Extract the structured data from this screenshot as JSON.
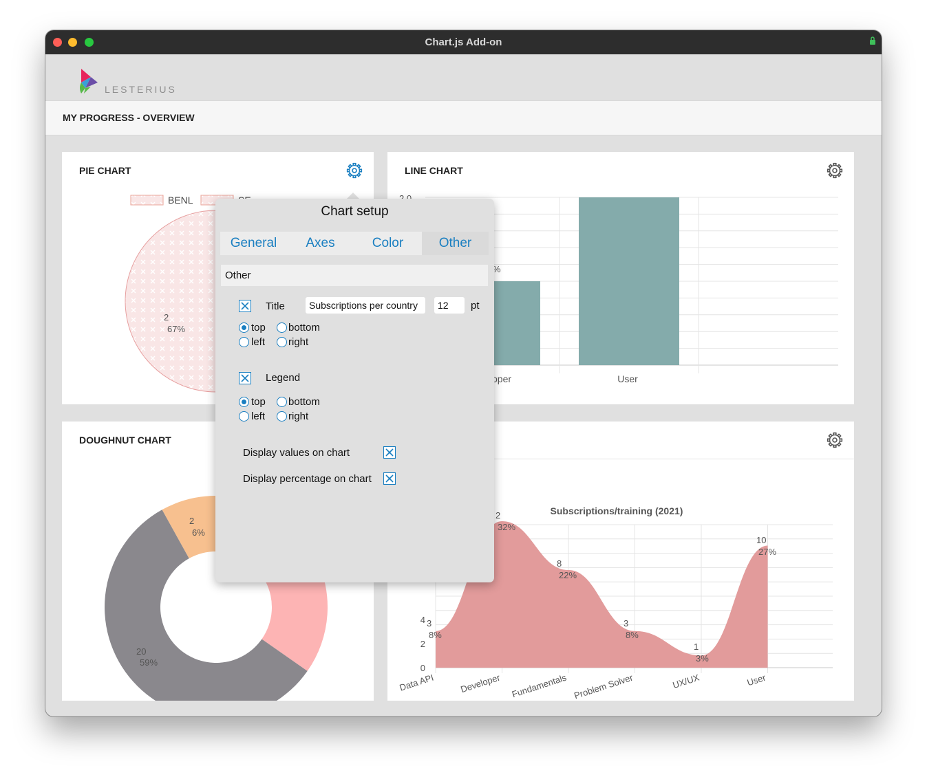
{
  "window": {
    "title": "Chart.js Add-on"
  },
  "brand": {
    "name": "LESTERIUS"
  },
  "page": {
    "title": "MY PROGRESS - OVERVIEW"
  },
  "cards": {
    "pie": {
      "title": "PIE CHART"
    },
    "line": {
      "title": "LINE CHART"
    },
    "doughnut": {
      "title": "DOUGHNUT CHART"
    }
  },
  "popover": {
    "title": "Chart setup",
    "tabs": [
      "General",
      "Axes",
      "Color",
      "Other"
    ],
    "active_tab": "Other",
    "section": "Other",
    "title_option": {
      "label": "Title",
      "checked": true,
      "text": "Subscriptions per country",
      "size": "12",
      "unit": "pt",
      "position": "top"
    },
    "legend_option": {
      "label": "Legend",
      "checked": true,
      "position": "top"
    },
    "positions": {
      "top": "top",
      "bottom": "bottom",
      "left": "left",
      "right": "right"
    },
    "display_values": {
      "label": "Display values on chart",
      "checked": true
    },
    "display_percentage": {
      "label": "Display percentage on chart",
      "checked": true
    }
  },
  "colors": {
    "accent": "#1a7fc1",
    "bar": "#84abab",
    "area": "#e29b9b",
    "doughnut_gray": "#8a888d",
    "doughnut_orange": "#f7c08f",
    "doughnut_pink": "#fdb4b4"
  },
  "chart_data": [
    {
      "type": "pie",
      "legend": [
        "BENL",
        "SE"
      ],
      "visible_labels": [
        {
          "value": "2",
          "percent": "67%"
        }
      ]
    },
    {
      "type": "bar",
      "y_tick_top": "2.0",
      "categories": [
        "oper",
        "User"
      ],
      "values": [
        1.0,
        2.0
      ],
      "ylim": [
        0,
        2
      ],
      "partial_label": "%"
    },
    {
      "type": "pie",
      "subtype": "doughnut",
      "slices": [
        {
          "value": "20",
          "percent": "59%",
          "color": "#8a888d"
        },
        {
          "value": "2",
          "percent": "6%",
          "color": "#f7c08f"
        },
        {
          "value": "",
          "percent": "",
          "color": "#fdb4b4"
        }
      ]
    },
    {
      "type": "area",
      "title": "Subscriptions/training (2021)",
      "categories": [
        "Data API",
        "Developer",
        "Fundamentals",
        "Problem Solver",
        "UX/UX",
        "User"
      ],
      "values": [
        3,
        12,
        8,
        3,
        1,
        10
      ],
      "value_labels": [
        "3",
        "2",
        "8",
        "3",
        "1",
        "10"
      ],
      "percent_labels": [
        "8%",
        "32%",
        "22%",
        "8%",
        "3%",
        "27%"
      ],
      "y_ticks": [
        "0",
        "2",
        "4"
      ],
      "ylim": [
        0,
        12
      ]
    }
  ]
}
